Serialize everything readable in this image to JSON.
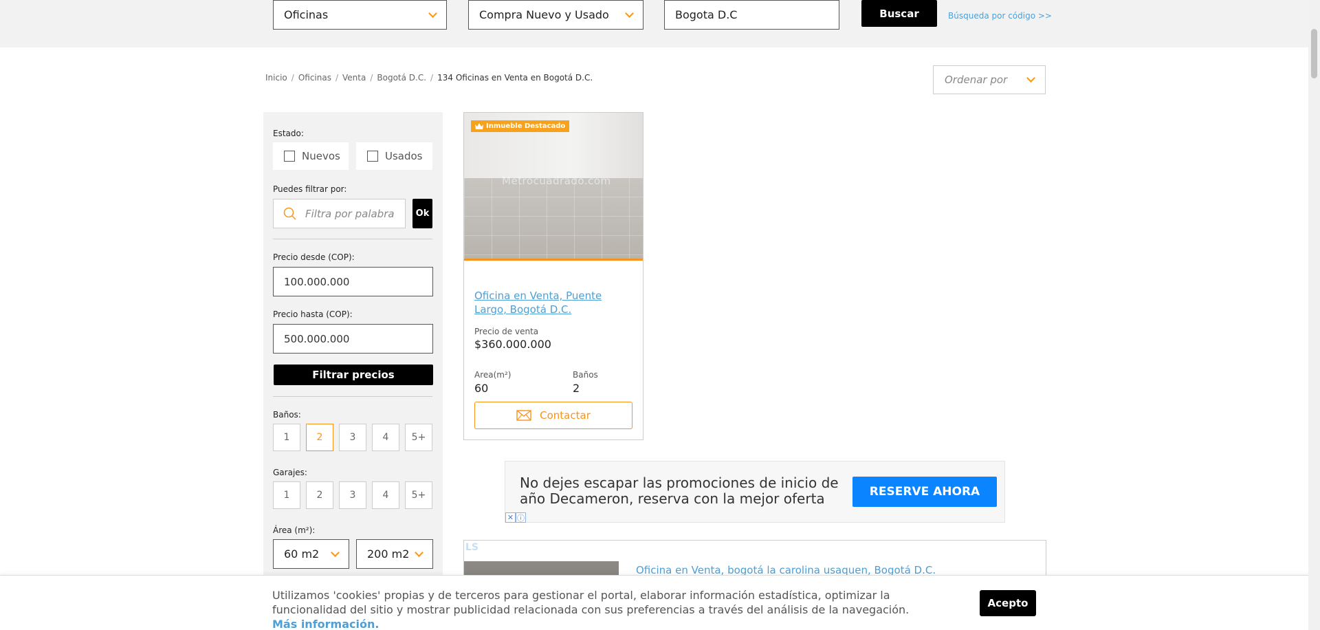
{
  "search": {
    "property_type": "Oficinas",
    "transaction": "Compra Nuevo y Usado",
    "city": "Bogota D.C",
    "search_button": "Buscar",
    "code_search_link": "Búsqueda por código >>"
  },
  "breadcrumb": {
    "items": [
      "Inicio",
      "Oficinas",
      "Venta",
      "Bogotá D.C."
    ],
    "separator": "/",
    "current": "134 Oficinas en Venta en Bogotá D.C."
  },
  "sort": {
    "placeholder": "Ordenar por"
  },
  "filters": {
    "estado_label": "Estado:",
    "estado_options": [
      "Nuevos",
      "Usados"
    ],
    "keyword_label": "Puedes filtrar por:",
    "keyword_placeholder": "Filtra por palabra",
    "keyword_ok": "Ok",
    "price_from_label": "Precio desde (COP):",
    "price_from_value": "100.000.000",
    "price_to_label": "Precio hasta (COP):",
    "price_to_value": "500.000.000",
    "filter_prices_button": "Filtrar precios",
    "banos_label": "Baños:",
    "banos_options": [
      "1",
      "2",
      "3",
      "4",
      "5+"
    ],
    "banos_selected": "2",
    "garajes_label": "Garajes:",
    "garajes_options": [
      "1",
      "2",
      "3",
      "4",
      "5+"
    ],
    "area_label": "Área (m²):",
    "area_from": "60 m2",
    "area_to": "200 m2"
  },
  "listing1": {
    "badge": "Inmueble Destacado",
    "watermark": "Metrocuadrado.com",
    "title": "Oficina en Venta, Puente Largo, Bogotá D.C.",
    "price_label": "Precio de venta",
    "price": "$360.000.000",
    "area_label": "Area(m²)",
    "area_value": "60",
    "banos_label": "Baños",
    "banos_value": "2",
    "contact_button": "Contactar"
  },
  "ad": {
    "text": "No dejes escapar las promociones de inicio de año Decameron, reserva con la mejor oferta",
    "cta": "RESERVE AHORA",
    "close": "✕",
    "info": "ⓘ"
  },
  "listing2": {
    "logo": "LS",
    "title": "Oficina en Venta, bogotá la carolina usaquen, Bogotá D.C."
  },
  "cookie": {
    "text": "Utilizamos 'cookies' propias y de terceros para gestionar el portal, elaborar información estadística, optimizar la funcionalidad del sitio y mostrar publicidad relacionada con sus preferencias a través del análisis de la navegación.",
    "more": "Más información.",
    "accept": "Acepto"
  },
  "colors": {
    "accent": "#f7941d",
    "link": "#4d9fd6",
    "ad_button": "#0a84ff"
  }
}
